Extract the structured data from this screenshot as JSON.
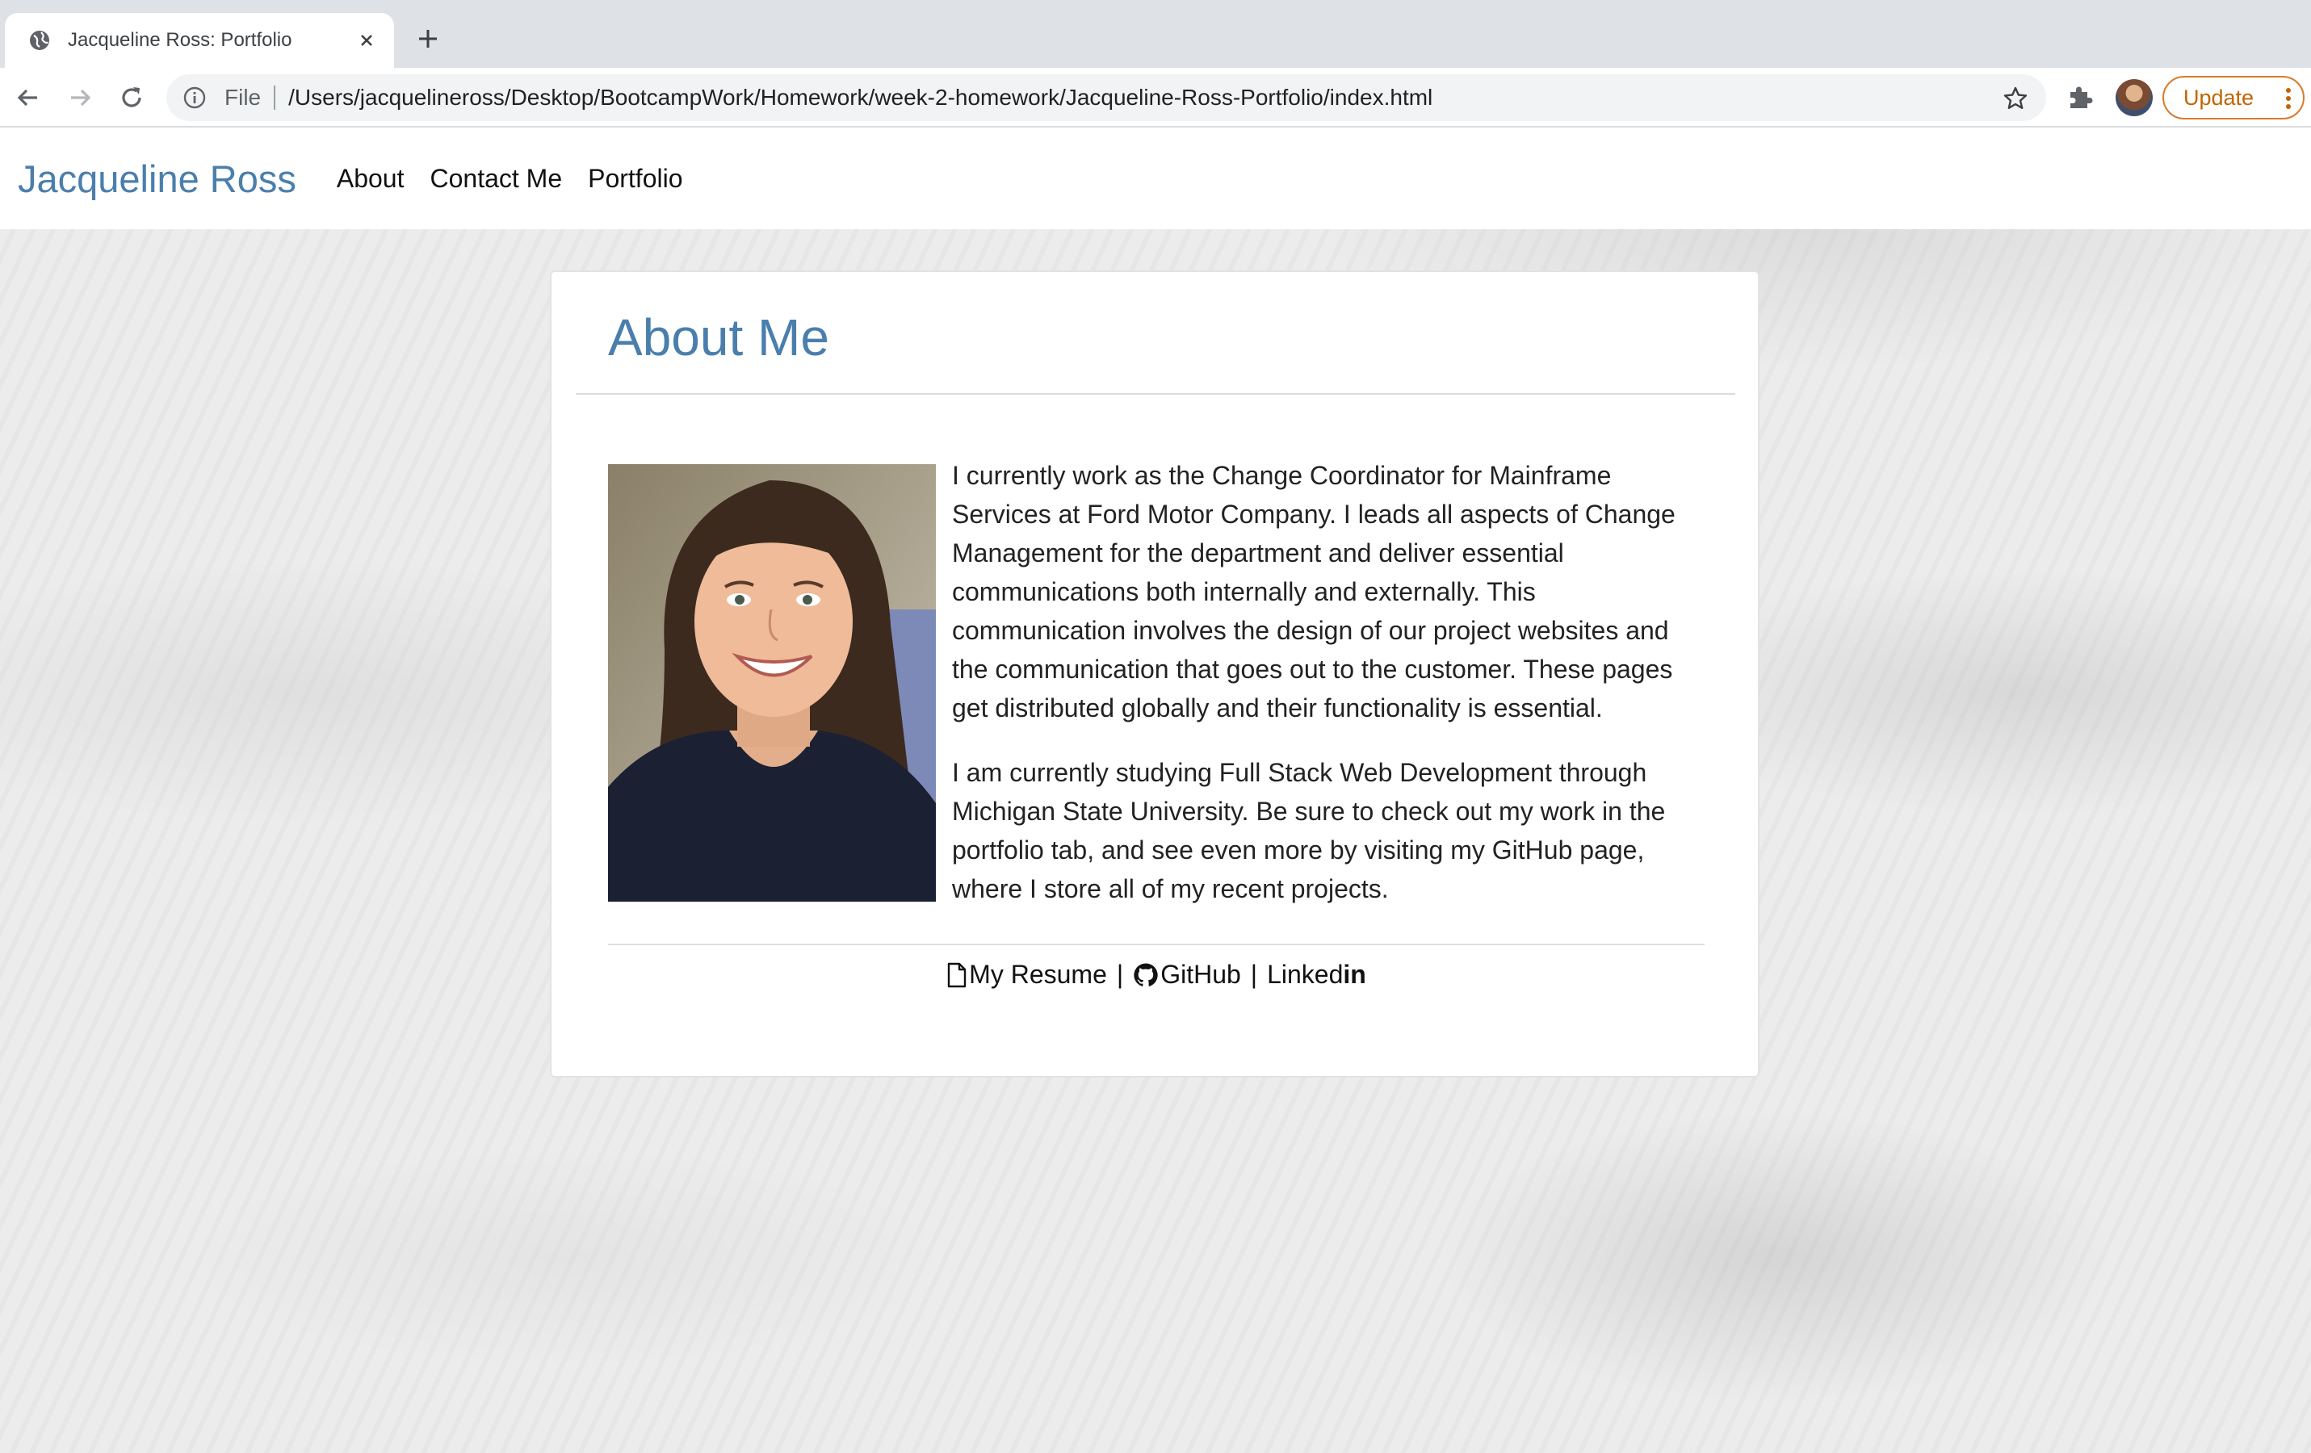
{
  "browser": {
    "tab_title": "Jacqueline Ross: Portfolio",
    "omnibox_scheme": "File",
    "url": "/Users/jacquelineross/Desktop/BootcampWork/Homework/week-2-homework/Jacqueline-Ross-Portfolio/index.html",
    "update_label": "Update",
    "icons": [
      "globe-icon",
      "close-icon",
      "plus-icon",
      "back-arrow-icon",
      "forward-arrow-icon",
      "reload-icon",
      "info-icon",
      "star-icon",
      "puzzle-icon",
      "avatar",
      "kebab-menu-icon"
    ]
  },
  "navbar": {
    "brand": "Jacqueline Ross",
    "links": [
      "About",
      "Contact Me",
      "Portfolio"
    ]
  },
  "about": {
    "heading": "About Me",
    "paragraphs": [
      "I currently work as the Change Coordinator for Mainframe Services at Ford Motor Company. I leads all aspects of Change Management for the department and deliver essential communications both internally and externally. This communication involves the design of our project websites and the communication that goes out to the customer. These pages get distributed globally and their functionality is essential.",
      "I am currently studying Full Stack Web Development through Michigan State University. Be sure to check out my work in the portfolio tab, and see even more by visiting my GitHub page, where I store all of my recent projects."
    ],
    "links": {
      "resume": "My Resume",
      "github": "GitHub",
      "linkedin": "Linked",
      "linkedin_mark": "in",
      "separator": "|"
    }
  },
  "colors": {
    "accent": "#4a7fad",
    "update_orange": "#c26401"
  }
}
